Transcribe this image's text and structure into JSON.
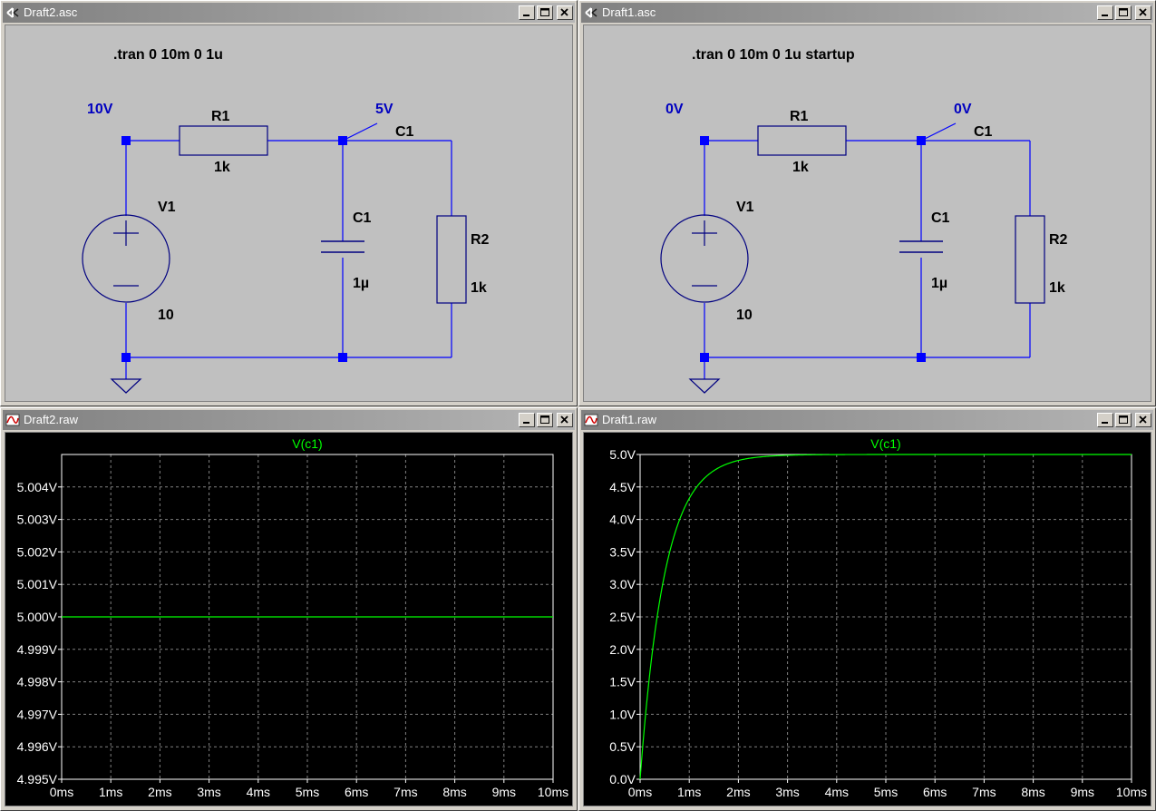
{
  "colors": {
    "wire": "#0000ff",
    "node": "#0000ff",
    "component": "#000080",
    "label": "#000000",
    "node_label": "#0000c0",
    "trace": "#00ff00",
    "grid": "#808080",
    "axis_text": "#ffffff"
  },
  "windows": [
    {
      "id": "draft2_asc",
      "title": "Draft2.asc",
      "icon": "ltspice-schematic-icon",
      "directive": ".tran 0 10m 0 1u",
      "node_v_in": "10V",
      "node_v_mid": "5V",
      "r1_name": "R1",
      "r1_value": "1k",
      "c1_net_label": "C1",
      "v1_name": "V1",
      "v1_value": "10",
      "c1_name": "C1",
      "c1_value": "1µ",
      "r2_name": "R2",
      "r2_value": "1k"
    },
    {
      "id": "draft1_asc",
      "title": "Draft1.asc",
      "icon": "ltspice-schematic-icon",
      "directive": ".tran 0 10m 0 1u startup",
      "node_v_in": "0V",
      "node_v_mid": "0V",
      "r1_name": "R1",
      "r1_value": "1k",
      "c1_net_label": "C1",
      "v1_name": "V1",
      "v1_value": "10",
      "c1_name": "C1",
      "c1_value": "1µ",
      "r2_name": "R2",
      "r2_value": "1k"
    }
  ],
  "plot_windows": [
    {
      "id": "draft2_raw",
      "title": "Draft2.raw",
      "icon": "waveform-icon"
    },
    {
      "id": "draft1_raw",
      "title": "Draft1.raw",
      "icon": "waveform-icon"
    }
  ],
  "chart_data": [
    {
      "type": "line",
      "title": "V(c1)",
      "x": [
        0,
        1,
        2,
        3,
        4,
        5,
        6,
        7,
        8,
        9,
        10
      ],
      "x_unit": "ms",
      "xticks": [
        "0ms",
        "1ms",
        "2ms",
        "3ms",
        "4ms",
        "5ms",
        "6ms",
        "7ms",
        "8ms",
        "9ms",
        "10ms"
      ],
      "yticks": [
        "4.995V",
        "4.996V",
        "4.997V",
        "4.998V",
        "4.999V",
        "5.000V",
        "5.001V",
        "5.002V",
        "5.003V",
        "5.004V"
      ],
      "ylim": [
        4.995,
        5.005
      ],
      "grid": true,
      "series": [
        {
          "name": "V(c1)",
          "y": [
            5.0,
            5.0,
            5.0,
            5.0,
            5.0,
            5.0,
            5.0,
            5.0,
            5.0,
            5.0,
            5.0
          ]
        }
      ]
    },
    {
      "type": "line",
      "title": "V(c1)",
      "x": [
        0,
        0.1,
        0.2,
        0.3,
        0.5,
        0.75,
        1,
        1.25,
        1.5,
        2,
        2.5,
        3,
        3.5,
        4,
        5,
        6,
        7,
        8,
        9,
        10
      ],
      "x_unit": "ms",
      "xticks": [
        "0ms",
        "1ms",
        "2ms",
        "3ms",
        "4ms",
        "5ms",
        "6ms",
        "7ms",
        "8ms",
        "9ms",
        "10ms"
      ],
      "yticks": [
        "0.0V",
        "0.5V",
        "1.0V",
        "1.5V",
        "2.0V",
        "2.5V",
        "3.0V",
        "3.5V",
        "4.0V",
        "4.5V",
        "5.0V"
      ],
      "ylim": [
        0,
        5
      ],
      "grid": true,
      "series": [
        {
          "name": "V(c1)",
          "y": [
            0,
            0.906,
            1.648,
            2.256,
            3.161,
            3.884,
            4.323,
            4.59,
            4.751,
            4.908,
            4.966,
            4.988,
            4.996,
            4.998,
            5.0,
            5.0,
            5.0,
            5.0,
            5.0,
            5.0
          ]
        }
      ]
    }
  ]
}
